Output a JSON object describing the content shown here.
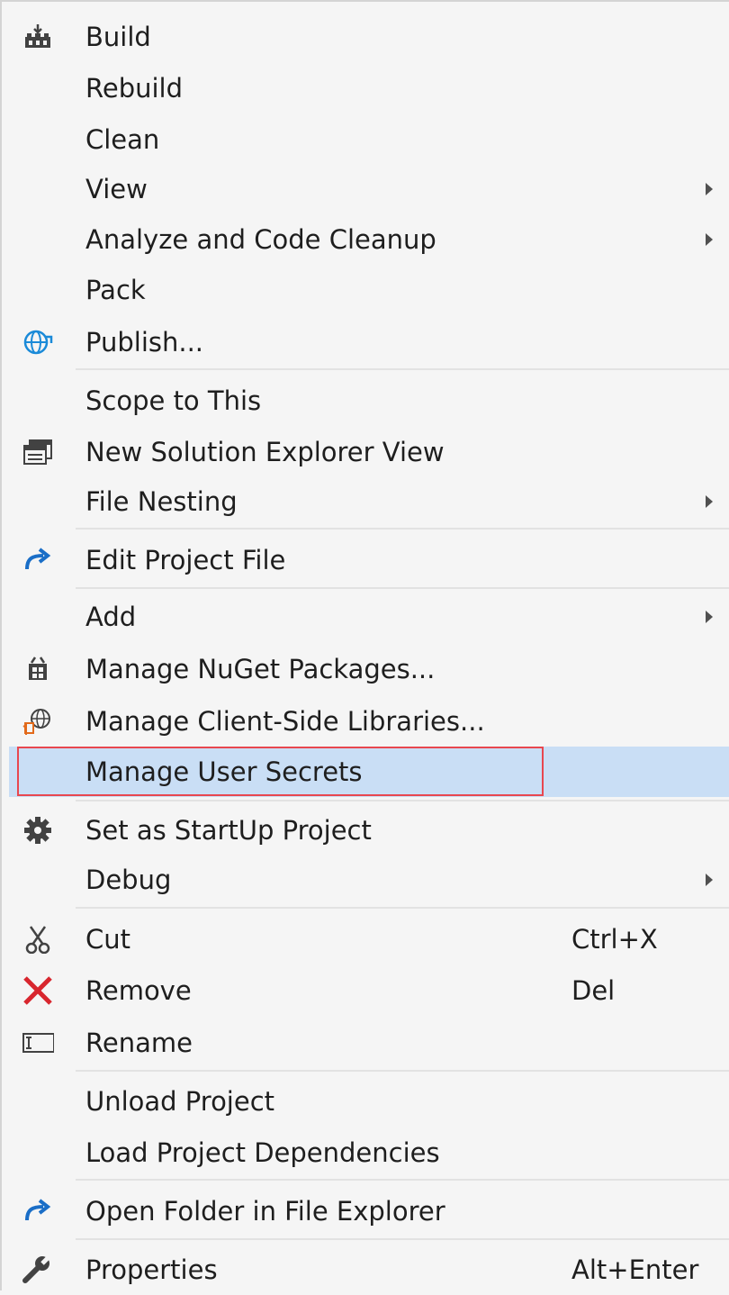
{
  "menu": {
    "build": "Build",
    "rebuild": "Rebuild",
    "clean": "Clean",
    "view": "View",
    "analyze": "Analyze and Code Cleanup",
    "pack": "Pack",
    "publish": "Publish...",
    "scope": "Scope to This",
    "new_se_view": "New Solution Explorer View",
    "file_nesting": "File Nesting",
    "edit_project": "Edit Project File",
    "add": "Add",
    "nuget": "Manage NuGet Packages...",
    "client_libs": "Manage Client-Side Libraries...",
    "user_secrets": "Manage User Secrets",
    "startup": "Set as StartUp Project",
    "debug": "Debug",
    "cut": "Cut",
    "cut_shortcut": "Ctrl+X",
    "remove": "Remove",
    "remove_shortcut": "Del",
    "rename": "Rename",
    "unload": "Unload Project",
    "load_deps": "Load Project Dependencies",
    "open_folder": "Open Folder in File Explorer",
    "properties": "Properties",
    "properties_shortcut": "Alt+Enter"
  },
  "colors": {
    "highlight": "#c9def5",
    "focus_border": "#e8474f",
    "accent_blue": "#1a6ec7",
    "remove_red": "#d8262e"
  }
}
